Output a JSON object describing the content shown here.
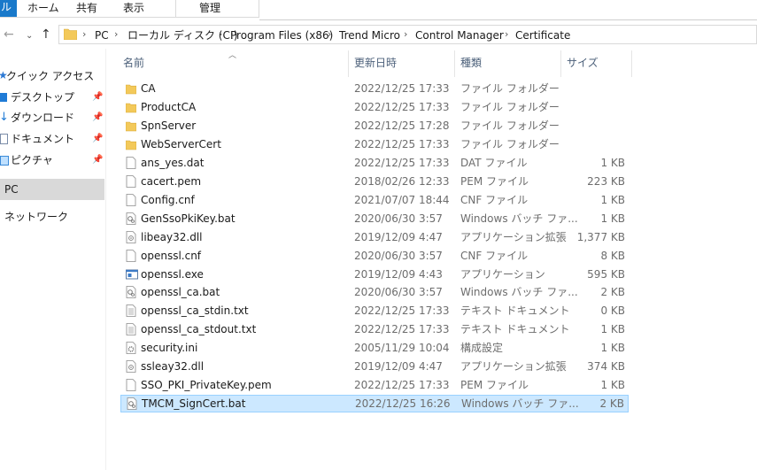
{
  "ribbon": {
    "file_tab": "ル",
    "tabs": [
      "ホーム",
      "共有",
      "表示"
    ],
    "context_tab": "管理"
  },
  "address": {
    "back_icon": "arrow-left-icon",
    "forward_icon": "arrow-right-icon",
    "recent_icon": "chevron-down-icon",
    "up_icon": "arrow-up-icon",
    "crumbs": [
      "PC",
      "ローカル ディスク (C:)",
      "Program Files (x86)",
      "Trend Micro",
      "Control Manager",
      "Certificate"
    ]
  },
  "nav": {
    "quick_access": "クイック アクセス",
    "pinned": [
      {
        "label": "デスクトップ",
        "icon": "desktop-icon"
      },
      {
        "label": "ダウンロード",
        "icon": "download-icon"
      },
      {
        "label": "ドキュメント",
        "icon": "document-icon"
      },
      {
        "label": "ピクチャ",
        "icon": "pictures-icon"
      }
    ],
    "pc": "PC",
    "network": "ネットワーク"
  },
  "columns": {
    "name": "名前",
    "date": "更新日時",
    "type": "種類",
    "size": "サイズ"
  },
  "files": [
    {
      "name": "CA",
      "date": "2022/12/25 17:33",
      "type": "ファイル フォルダー",
      "size": "",
      "icon": "folder-icon"
    },
    {
      "name": "ProductCA",
      "date": "2022/12/25 17:33",
      "type": "ファイル フォルダー",
      "size": "",
      "icon": "folder-icon"
    },
    {
      "name": "SpnServer",
      "date": "2022/12/25 17:28",
      "type": "ファイル フォルダー",
      "size": "",
      "icon": "folder-icon"
    },
    {
      "name": "WebServerCert",
      "date": "2022/12/25 17:33",
      "type": "ファイル フォルダー",
      "size": "",
      "icon": "folder-icon"
    },
    {
      "name": "ans_yes.dat",
      "date": "2022/12/25 17:33",
      "type": "DAT ファイル",
      "size": "1 KB",
      "icon": "file-icon"
    },
    {
      "name": "cacert.pem",
      "date": "2018/02/26 12:33",
      "type": "PEM ファイル",
      "size": "223 KB",
      "icon": "file-icon"
    },
    {
      "name": "Config.cnf",
      "date": "2021/07/07 18:44",
      "type": "CNF ファイル",
      "size": "1 KB",
      "icon": "file-icon"
    },
    {
      "name": "GenSsoPkiKey.bat",
      "date": "2020/06/30 3:57",
      "type": "Windows バッチ ファ...",
      "size": "1 KB",
      "icon": "batch-file-icon"
    },
    {
      "name": "libeay32.dll",
      "date": "2019/12/09 4:47",
      "type": "アプリケーション拡張",
      "size": "1,377 KB",
      "icon": "dll-file-icon"
    },
    {
      "name": "openssl.cnf",
      "date": "2020/06/30 3:57",
      "type": "CNF ファイル",
      "size": "8 KB",
      "icon": "file-icon"
    },
    {
      "name": "openssl.exe",
      "date": "2019/12/09 4:43",
      "type": "アプリケーション",
      "size": "595 KB",
      "icon": "exe-file-icon"
    },
    {
      "name": "openssl_ca.bat",
      "date": "2020/06/30 3:57",
      "type": "Windows バッチ ファ...",
      "size": "2 KB",
      "icon": "batch-file-icon"
    },
    {
      "name": "openssl_ca_stdin.txt",
      "date": "2022/12/25 17:33",
      "type": "テキスト ドキュメント",
      "size": "0 KB",
      "icon": "text-file-icon"
    },
    {
      "name": "openssl_ca_stdout.txt",
      "date": "2022/12/25 17:33",
      "type": "テキスト ドキュメント",
      "size": "1 KB",
      "icon": "text-file-icon"
    },
    {
      "name": "security.ini",
      "date": "2005/11/29 10:04",
      "type": "構成設定",
      "size": "1 KB",
      "icon": "ini-file-icon"
    },
    {
      "name": "ssleay32.dll",
      "date": "2019/12/09 4:47",
      "type": "アプリケーション拡張",
      "size": "374 KB",
      "icon": "dll-file-icon"
    },
    {
      "name": "SSO_PKI_PrivateKey.pem",
      "date": "2022/12/25 17:33",
      "type": "PEM ファイル",
      "size": "1 KB",
      "icon": "file-icon"
    },
    {
      "name": "TMCM_SignCert.bat",
      "date": "2022/12/25 16:26",
      "type": "Windows バッチ ファ...",
      "size": "2 KB",
      "icon": "batch-file-icon",
      "selected": true
    }
  ],
  "colors": {
    "folder": "#f3c95a",
    "selection": "#cce8ff",
    "selection_border": "#99d1ff",
    "header_text": "#4c607a",
    "file_tab": "#1979ca"
  }
}
